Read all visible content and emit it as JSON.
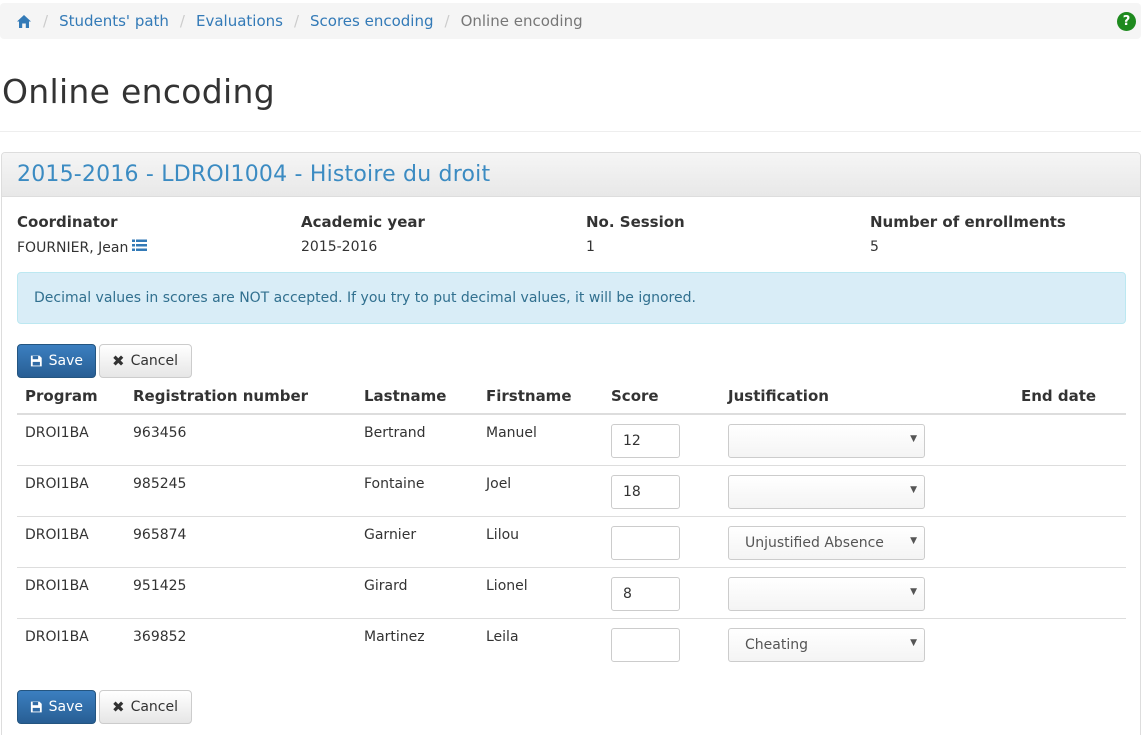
{
  "breadcrumb": {
    "home_icon": "home-icon",
    "items": [
      "Students' path",
      "Evaluations",
      "Scores encoding"
    ],
    "active": "Online encoding",
    "help_icon": "?"
  },
  "page": {
    "title": "Online encoding"
  },
  "panel": {
    "title": "2015-2016 - LDROI1004 - Histoire du droit",
    "info": [
      {
        "label": "Coordinator",
        "value": "FOURNIER, Jean"
      },
      {
        "label": "Academic year",
        "value": "2015-2016"
      },
      {
        "label": "No. Session",
        "value": "1"
      },
      {
        "label": "Number of enrollments",
        "value": "5"
      }
    ],
    "alert": "Decimal values in scores are NOT accepted. If you try to put decimal values, it will be ignored.",
    "buttons": {
      "save": "Save",
      "cancel": "Cancel"
    }
  },
  "table": {
    "headers": [
      "Program",
      "Registration number",
      "Lastname",
      "Firstname",
      "Score",
      "Justification",
      "End date"
    ],
    "rows": [
      {
        "program": "DROI1BA",
        "registration": "963456",
        "lastname": "Bertrand",
        "firstname": "Manuel",
        "score": "12",
        "justification": ""
      },
      {
        "program": "DROI1BA",
        "registration": "985245",
        "lastname": "Fontaine",
        "firstname": "Joel",
        "score": "18",
        "justification": ""
      },
      {
        "program": "DROI1BA",
        "registration": "965874",
        "lastname": "Garnier",
        "firstname": "Lilou",
        "score": "",
        "justification": "Unjustified Absence"
      },
      {
        "program": "DROI1BA",
        "registration": "951425",
        "lastname": "Girard",
        "firstname": "Lionel",
        "score": "8",
        "justification": ""
      },
      {
        "program": "DROI1BA",
        "registration": "369852",
        "lastname": "Martinez",
        "firstname": "Leila",
        "score": "",
        "justification": "Cheating"
      }
    ]
  },
  "colors": {
    "link": "#337ab7",
    "primary": "#285e94",
    "alert_bg": "#d9edf7",
    "alert_text": "#31708f",
    "help": "#1e8a1e"
  }
}
